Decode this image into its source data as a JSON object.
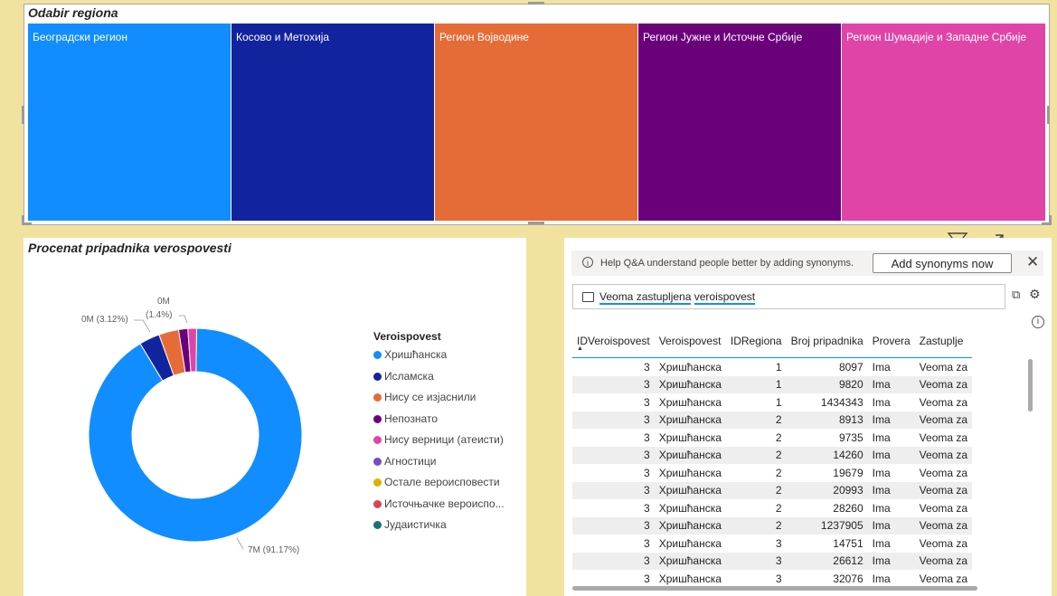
{
  "treemap": {
    "title": "Odabir regiona",
    "tiles": [
      {
        "label": "Београдски регион",
        "color": "#118dff"
      },
      {
        "label": "Косово и Метохија",
        "color": "#12239e"
      },
      {
        "label": "Регион Војводине",
        "color": "#e66c37"
      },
      {
        "label": "Регион Јужне и Источне Србије",
        "color": "#6b007b"
      },
      {
        "label": "Регион Шумадије и Западне Србије",
        "color": "#e044a7"
      }
    ]
  },
  "donut": {
    "title": "Procenat pripadnika verospovesti",
    "labels": {
      "large": "7M (91.17%)",
      "mid": "0M (3.12%)",
      "small_top": "0M",
      "small_bottom": "(1.4%)"
    },
    "legend_title": "Veroispovest",
    "legend": [
      {
        "label": "Хришћанска",
        "color": "#118dff"
      },
      {
        "label": "Исламска",
        "color": "#12239e"
      },
      {
        "label": "Нису се изјаснили",
        "color": "#e66c37"
      },
      {
        "label": "Непознато",
        "color": "#6b007b"
      },
      {
        "label": "Нису верници (атеисти)",
        "color": "#e044a7"
      },
      {
        "label": "Агностици",
        "color": "#744ec2"
      },
      {
        "label": "Остале вероисповести",
        "color": "#d9b300"
      },
      {
        "label": "Источњачке вероиспо...",
        "color": "#d64550"
      },
      {
        "label": "Јудаистичка",
        "color": "#197278"
      }
    ],
    "slices": [
      {
        "name": "Хришћанска",
        "percent": 91.17,
        "color": "#118dff"
      },
      {
        "name": "Исламска",
        "percent": 3.12,
        "color": "#12239e"
      },
      {
        "name": "Нису се изјаснили",
        "percent": 3.0,
        "color": "#e66c37"
      },
      {
        "name": "Непознато",
        "percent": 1.4,
        "color": "#6b007b"
      },
      {
        "name": "Нису верници (атеисти)",
        "percent": 1.31,
        "color": "#e044a7"
      }
    ]
  },
  "qa": {
    "help_text": "Help Q&A understand people better by adding synonyms.",
    "add_button": "Add synonyms now",
    "close_icon": "close-icon",
    "query_word1": "Veoma zastupljena",
    "query_word2": "veroispovest"
  },
  "table": {
    "headers": [
      "IDVeroispovest",
      "Veroispovest",
      "IDRegiona",
      "Broj pripadnika",
      "Provera",
      "Zastuplje"
    ],
    "rows": [
      [
        "3",
        "Хришћанска",
        "1",
        "8097",
        "Ima",
        "Veoma za"
      ],
      [
        "3",
        "Хришћанска",
        "1",
        "9820",
        "Ima",
        "Veoma za"
      ],
      [
        "3",
        "Хришћанска",
        "1",
        "1434343",
        "Ima",
        "Veoma za"
      ],
      [
        "3",
        "Хришћанска",
        "2",
        "8913",
        "Ima",
        "Veoma za"
      ],
      [
        "3",
        "Хришћанска",
        "2",
        "9735",
        "Ima",
        "Veoma za"
      ],
      [
        "3",
        "Хришћанска",
        "2",
        "14260",
        "Ima",
        "Veoma za"
      ],
      [
        "3",
        "Хришћанска",
        "2",
        "19679",
        "Ima",
        "Veoma za"
      ],
      [
        "3",
        "Хришћанска",
        "2",
        "20993",
        "Ima",
        "Veoma za"
      ],
      [
        "3",
        "Хришћанска",
        "2",
        "28260",
        "Ima",
        "Veoma za"
      ],
      [
        "3",
        "Хришћанска",
        "2",
        "1237905",
        "Ima",
        "Veoma za"
      ],
      [
        "3",
        "Хришћанска",
        "3",
        "14751",
        "Ima",
        "Veoma za"
      ],
      [
        "3",
        "Хришћанска",
        "3",
        "26612",
        "Ima",
        "Veoma za"
      ],
      [
        "3",
        "Хришћанска",
        "3",
        "32076",
        "Ima",
        "Veoma za"
      ]
    ]
  }
}
